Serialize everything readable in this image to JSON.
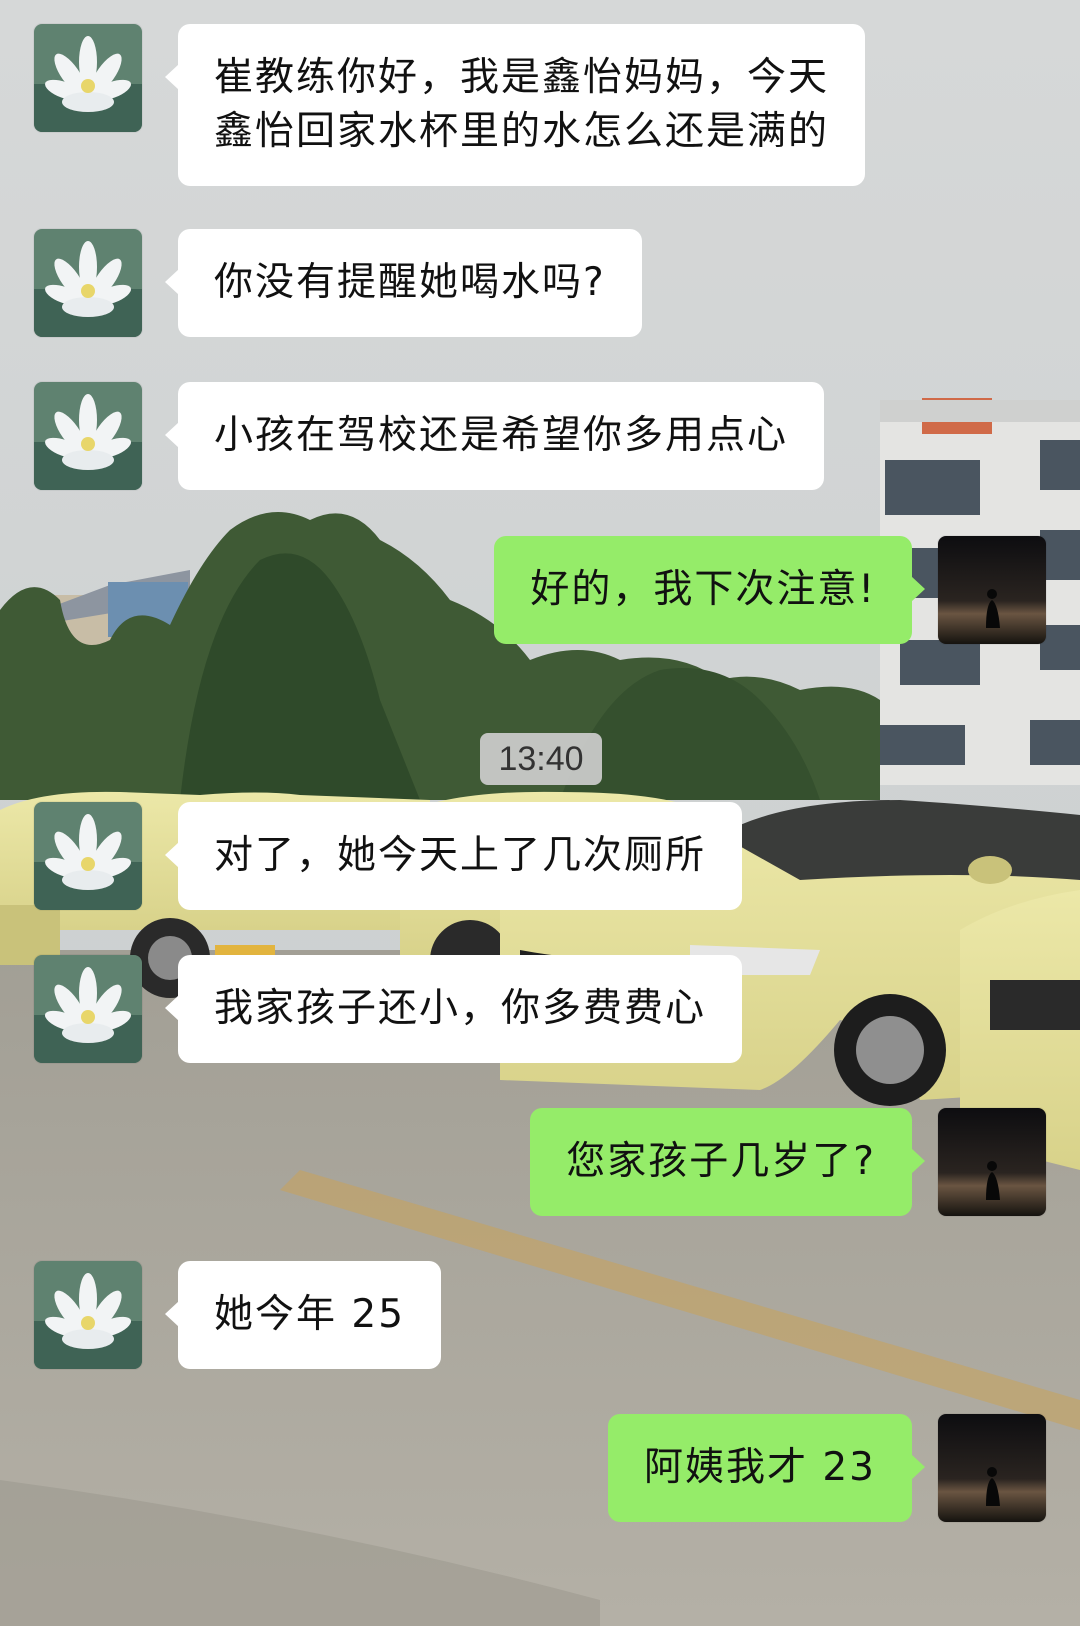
{
  "chat": {
    "timestamp": "13:40",
    "messages": [
      {
        "side": "left",
        "avatar": "lotus-icon",
        "lines": [
          "崔教练你好，我是鑫怡妈妈，今天",
          "鑫怡回家水杯里的水怎么还是满的"
        ]
      },
      {
        "side": "left",
        "avatar": "lotus-icon",
        "lines": [
          "你没有提醒她喝水吗?"
        ]
      },
      {
        "side": "left",
        "avatar": "lotus-icon",
        "lines": [
          "小孩在驾校还是希望你多用点心"
        ]
      },
      {
        "side": "right",
        "avatar": "silhouette-icon",
        "lines": [
          "好的，我下次注意!"
        ]
      },
      {
        "side": "left",
        "avatar": "lotus-icon",
        "lines": [
          "对了，她今天上了几次厕所"
        ]
      },
      {
        "side": "left",
        "avatar": "lotus-icon",
        "lines": [
          "我家孩子还小，你多费费心"
        ]
      },
      {
        "side": "right",
        "avatar": "silhouette-icon",
        "lines": [
          "您家孩子几岁了?"
        ]
      },
      {
        "side": "left",
        "avatar": "lotus-icon",
        "lines": [
          "她今年 25"
        ]
      },
      {
        "side": "right",
        "avatar": "silhouette-icon",
        "lines": [
          "阿姨我才 23"
        ]
      }
    ]
  },
  "colors": {
    "incoming_bubble": "#ffffff",
    "outgoing_bubble": "#95ec69",
    "timestamp_pill": "#cdcdcd"
  }
}
